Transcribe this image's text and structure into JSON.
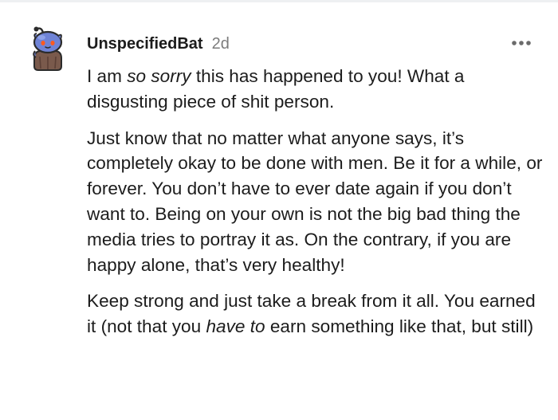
{
  "comment": {
    "author": "UnspecifiedBat",
    "age": "2d",
    "more_icon": "more-horizontal-icon",
    "avatar_icon": "snoo-avatar-icon",
    "paragraphs": [
      {
        "t1": "I am ",
        "em1": "so sorry",
        "t2": " this has happened to you! What a disgusting piece of shit person."
      },
      {
        "text": "Just know that no matter what anyone says, it’s completely okay to be done with men. Be it for a while, or forever. You don’t have to ever date again if you don’t want to. Being on your own is not the big bad thing the media tries to portray it as. On the contrary, if you are happy alone, that’s very healthy!"
      },
      {
        "t1": "Keep strong and just take a break from it all. You earned it (not that you ",
        "em1": "have to",
        "t2": " earn something like that, but still)"
      }
    ]
  },
  "colors": {
    "author": "#1c1c1c",
    "timestamp": "#7c7c7c",
    "body_text": "#1c1c1c",
    "avatar_fur": "#6f83d6",
    "avatar_body": "#7a5a4c"
  }
}
